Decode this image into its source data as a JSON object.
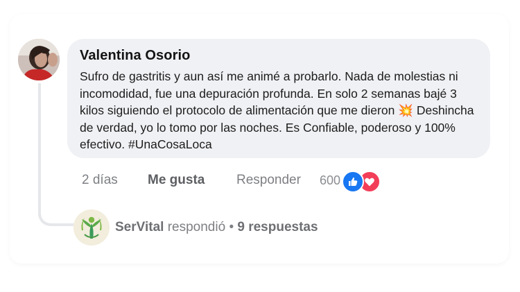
{
  "comment": {
    "author": "Valentina Osorio",
    "text": "Sufro de gastritis y aun así me animé a probarlo. Nada de molestias ni incomodidad, fue una depuración profunda. En solo 2 semanas bajé 3 kilos siguiendo el protocolo de alimentación que me dieron 💥 Deshincha de verdad, yo lo tomo por las noches. Es Confiable, poderoso y 100% efectivo. #UnaCosaLoca",
    "time": "2 días",
    "like_label": "Me gusta",
    "reply_label": "Responder",
    "reaction_count": "600",
    "reactions": [
      "like-icon",
      "love-icon"
    ]
  },
  "reply": {
    "author": "SerVital",
    "action": "respondió",
    "separator": "•",
    "count_label": "9 respuestas"
  },
  "colors": {
    "bubble": "#f0f1f4",
    "like": "#1877f2",
    "love": "#f33e58",
    "muted_text": "#7d7f83"
  }
}
